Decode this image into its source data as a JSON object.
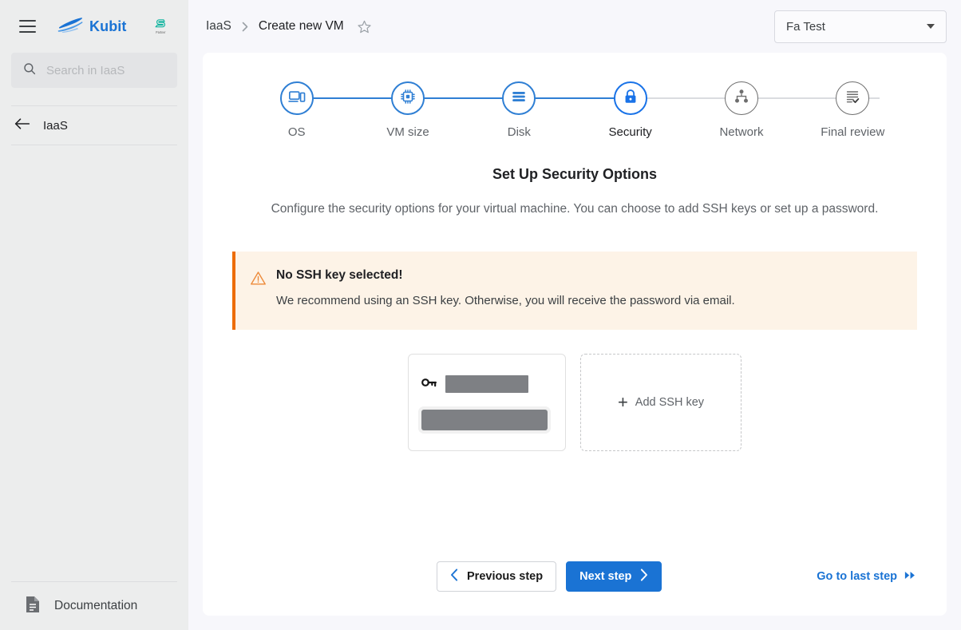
{
  "sidebar": {
    "menu_icon": "hamburger-icon",
    "brand": {
      "name": "Kubit",
      "logo_icon": "kubit-boat-logo"
    },
    "partner_logo": {
      "mark": "S",
      "caption": "Partner"
    },
    "search": {
      "placeholder": "Search in IaaS",
      "value": "",
      "icon": "search-icon"
    },
    "back_item": {
      "label": "IaaS",
      "icon": "arrow-left-icon"
    },
    "documentation": {
      "label": "Documentation",
      "icon": "document-icon"
    }
  },
  "topbar": {
    "breadcrumb": [
      {
        "label": "IaaS"
      },
      {
        "label": "Create new VM"
      }
    ],
    "separator": "›",
    "favorite_icon": "star-icon",
    "account": {
      "label": "Fa Test",
      "caret_icon": "chevron-down-icon"
    }
  },
  "stepper": {
    "steps": [
      {
        "label": "OS",
        "icon": "devices-icon",
        "state": "done"
      },
      {
        "label": "VM size",
        "icon": "cpu-icon",
        "state": "done"
      },
      {
        "label": "Disk",
        "icon": "storage-icon",
        "state": "done"
      },
      {
        "label": "Security",
        "icon": "lock-icon",
        "state": "active"
      },
      {
        "label": "Network",
        "icon": "network-icon",
        "state": "pending"
      },
      {
        "label": "Final review",
        "icon": "checklist-icon",
        "state": "pending"
      }
    ]
  },
  "content": {
    "title": "Set Up Security Options",
    "description": "Configure the security options for your virtual machine. You can choose to add SSH keys or set up a password.",
    "warning": {
      "icon": "warning-triangle-icon",
      "title": "No SSH key selected!",
      "text": "We recommend using an SSH key. Otherwise, you will receive the password via email.",
      "accent_color": "#ed6c02",
      "background_color": "#fdf3e7"
    },
    "ssh_keys": [
      {
        "icon": "key-icon",
        "name_redacted": true,
        "fingerprint_redacted": true
      }
    ],
    "add_ssh_key": {
      "label": "Add SSH key",
      "icon": "plus-icon"
    }
  },
  "footer": {
    "previous": {
      "label": "Previous step",
      "icon": "chevron-left-icon"
    },
    "next": {
      "label": "Next step",
      "icon": "chevron-right-icon"
    },
    "last": {
      "label": "Go to last step",
      "icon": "double-chevron-right-icon"
    }
  },
  "colors": {
    "brand_blue": "#1a73d4",
    "step_blue": "#2f7fd4",
    "page_bg": "#f7f7fb",
    "sidebar_bg": "#eceded",
    "warning_orange": "#ed6c02"
  }
}
